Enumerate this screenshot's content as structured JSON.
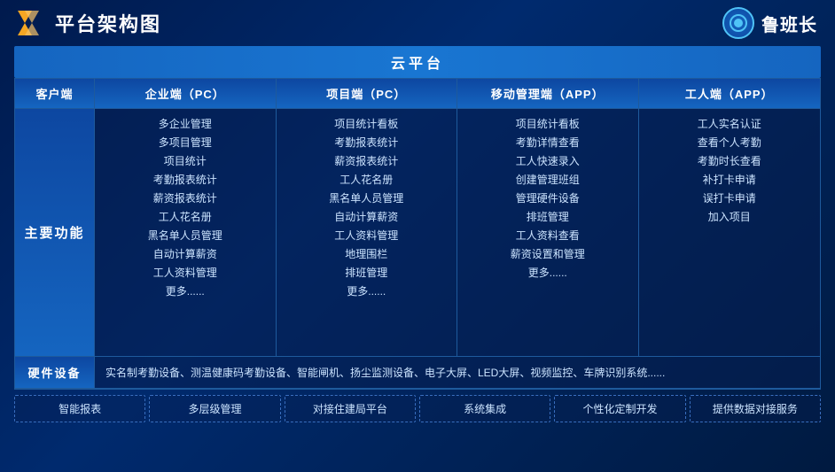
{
  "header": {
    "title": "平台架构图",
    "brand_name": "鲁班长"
  },
  "cloud_platform": {
    "label": "云平台"
  },
  "columns": {
    "client": "客户端",
    "enterprise_pc": "企业端（PC）",
    "project_pc": "项目端（PC）",
    "mobile_app": "移动管理端（APP）",
    "worker_app": "工人端（APP）"
  },
  "main_features": {
    "label": "主要功能",
    "enterprise": [
      "多企业管理",
      "多项目管理",
      "项目统计",
      "考勤报表统计",
      "薪资报表统计",
      "工人花名册",
      "黑名单人员管理",
      "自动计算薪资",
      "工人资料管理",
      "更多......"
    ],
    "project": [
      "项目统计看板",
      "考勤报表统计",
      "薪资报表统计",
      "工人花名册",
      "黑名单人员管理",
      "自动计算薪资",
      "工人资料管理",
      "地理围栏",
      "排班管理",
      "更多......"
    ],
    "mobile": [
      "项目统计看板",
      "考勤详情查看",
      "工人快速录入",
      "创建管理班组",
      "管理硬件设备",
      "排班管理",
      "工人资料查看",
      "薪资设置和管理",
      "更多......"
    ],
    "worker": [
      "工人实名认证",
      "查看个人考勤",
      "考勤时长查看",
      "补打卡申请",
      "误打卡申请",
      "加入项目"
    ]
  },
  "hardware": {
    "label": "硬件设备",
    "content": "实名制考勤设备、测温健康码考勤设备、智能闸机、扬尘监测设备、电子大屏、LED大屏、视频监控、车牌识别系统......"
  },
  "tags": [
    "智能报表",
    "多层级管理",
    "对接住建局平台",
    "系统集成",
    "个性化定制开发",
    "提供数据对接服务"
  ]
}
